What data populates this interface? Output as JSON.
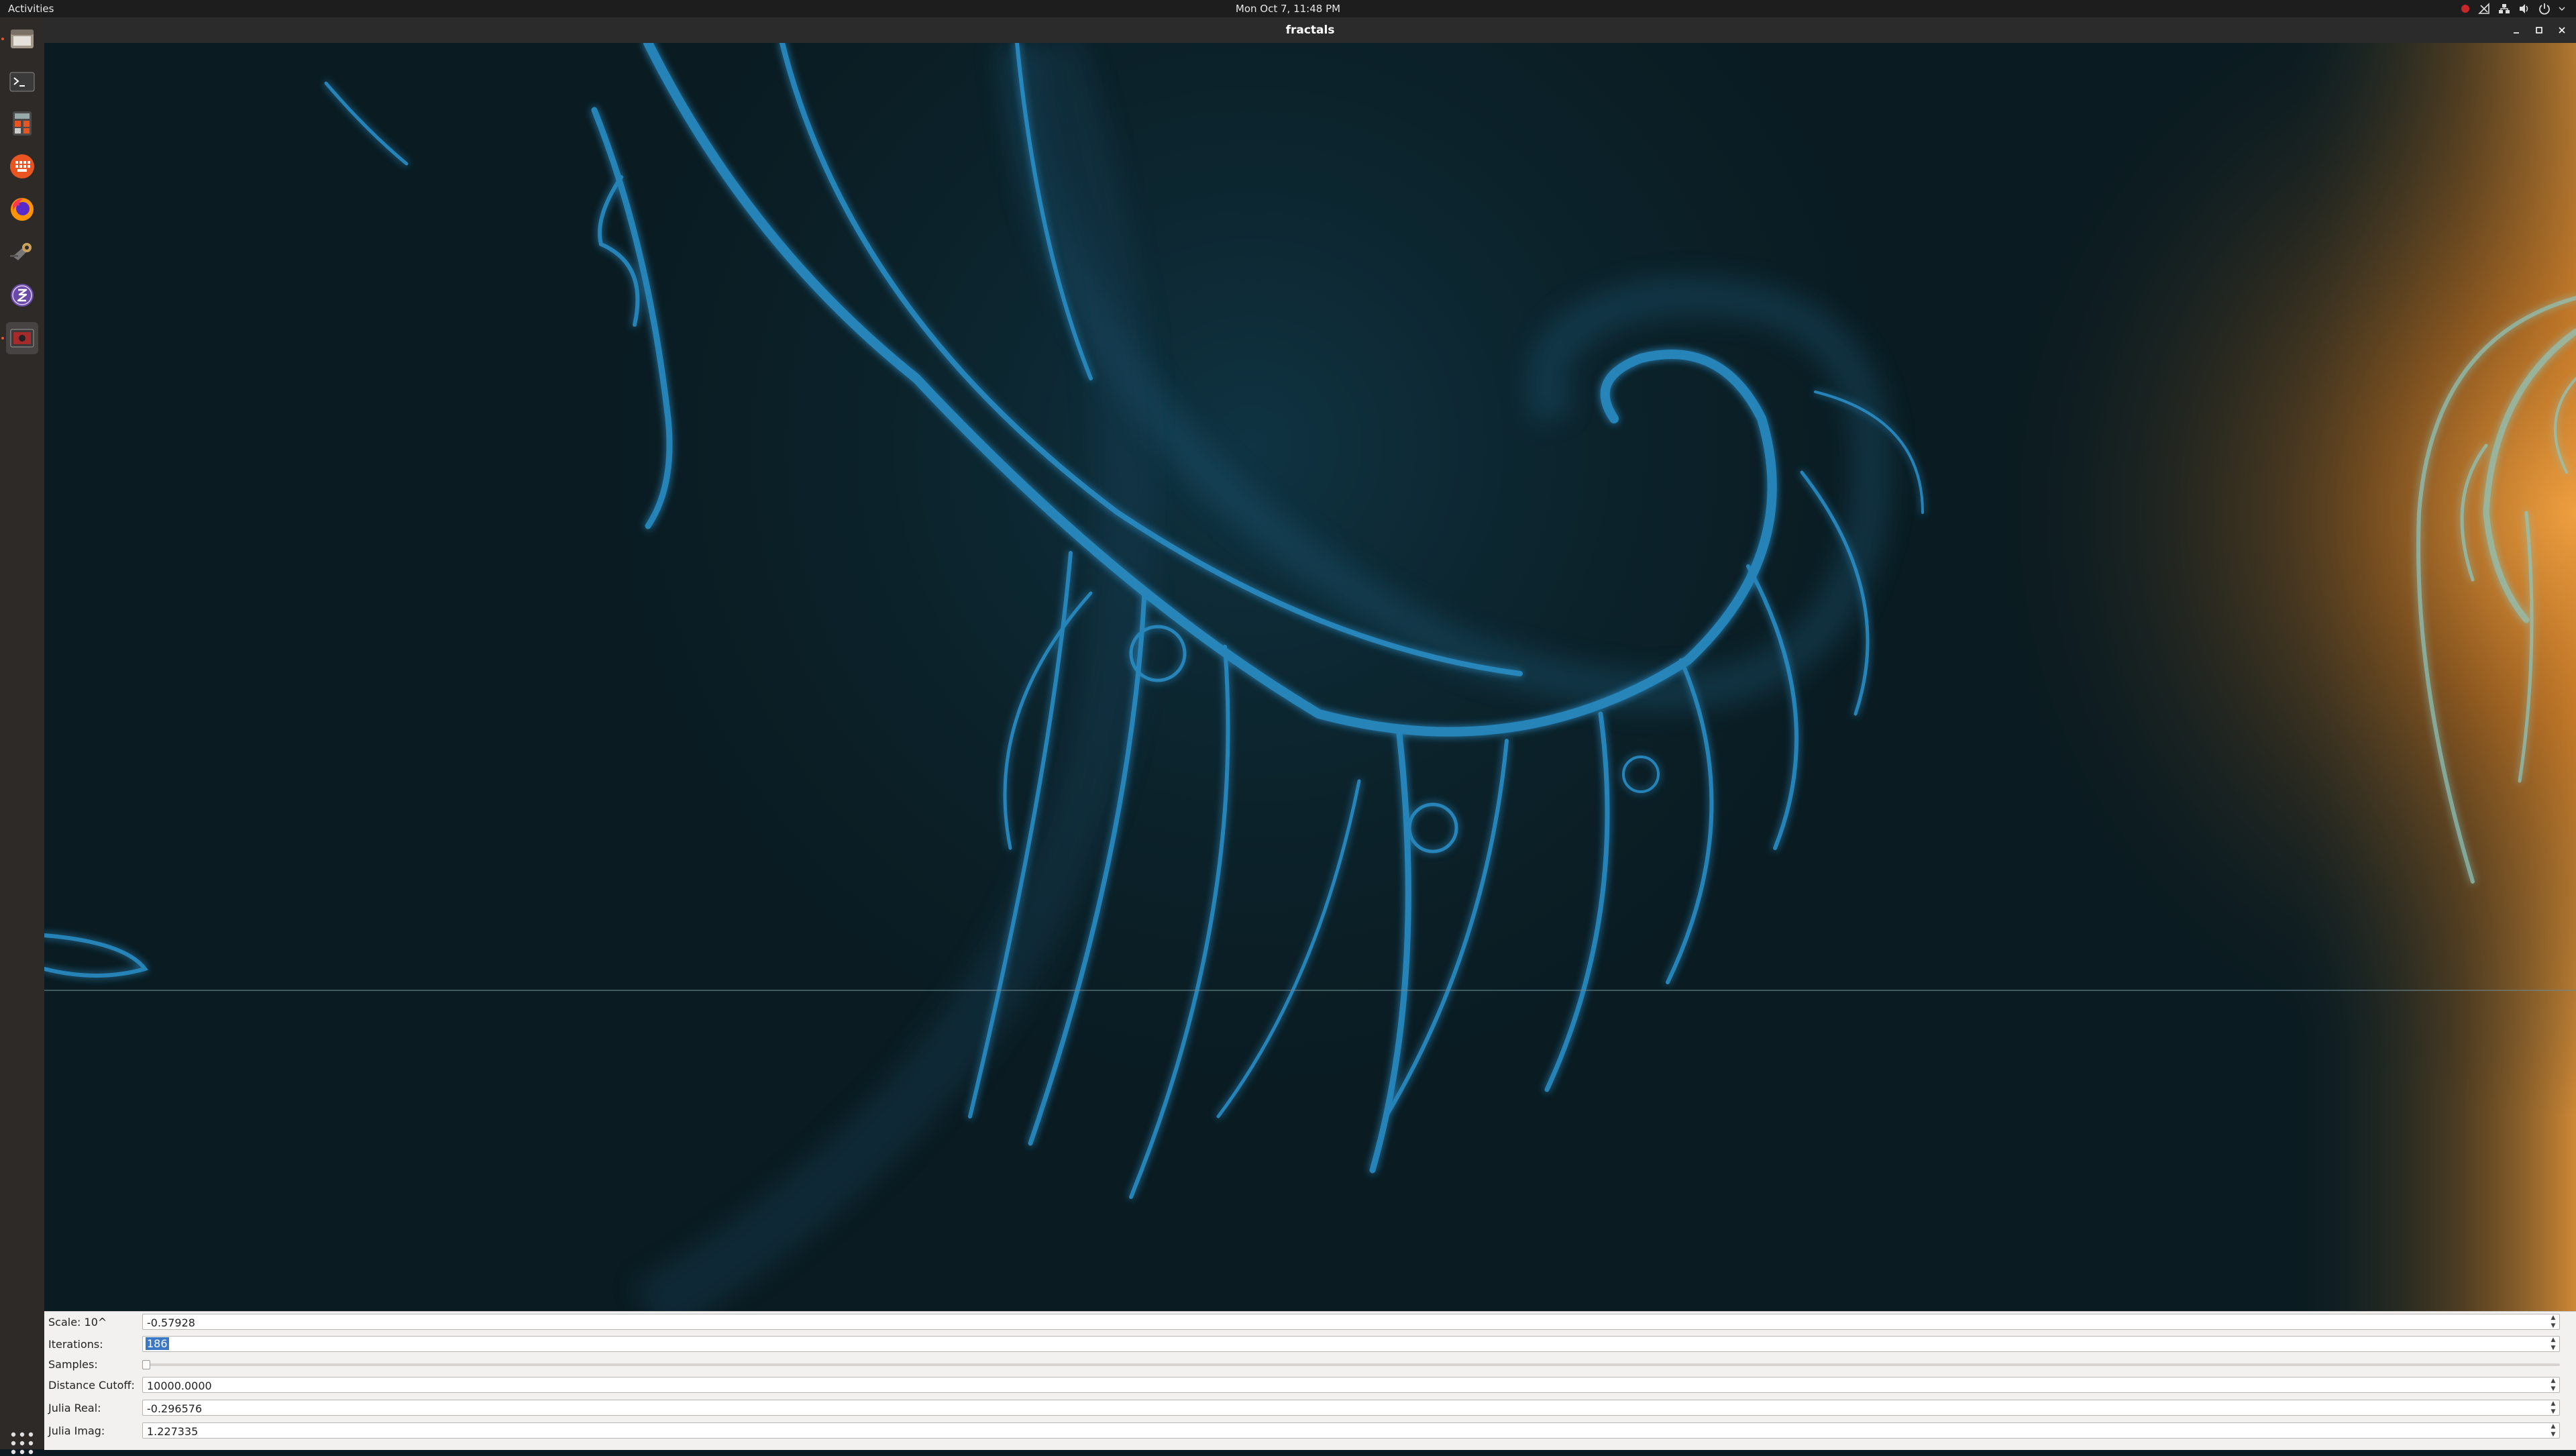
{
  "topbar": {
    "activities": "Activities",
    "clock": "Mon Oct  7, 11:48 PM",
    "tray_icons": [
      "record-indicator-icon",
      "network-icon",
      "volume-icon",
      "power-icon",
      "system-menu-chevron-icon"
    ]
  },
  "dock": {
    "items": [
      {
        "name": "files",
        "icon": "file-manager-icon"
      },
      {
        "name": "terminal",
        "icon": "terminal-icon"
      },
      {
        "name": "calculator",
        "icon": "calculator-icon"
      },
      {
        "name": "apps",
        "icon": "orange-grid-app-icon"
      },
      {
        "name": "firefox",
        "icon": "firefox-icon"
      },
      {
        "name": "tools",
        "icon": "wrench-tools-icon"
      },
      {
        "name": "emacs",
        "icon": "emacs-icon"
      },
      {
        "name": "fractals",
        "icon": "fractals-window-icon"
      }
    ],
    "show_apps_icon": "show-applications-grid-icon"
  },
  "window": {
    "title": "fractals",
    "controls": [
      "minimize-icon",
      "maximize-icon",
      "close-icon"
    ]
  },
  "controls": {
    "scale": {
      "label": "Scale: 10^",
      "value": "-0.57928"
    },
    "iterations": {
      "label": "Iterations:",
      "value": "186"
    },
    "samples": {
      "label": "Samples:",
      "level": 0.0
    },
    "distance_cutoff": {
      "label": "Distance Cutoff:",
      "value": "10000.0000"
    },
    "julia_real": {
      "label": "Julia Real:",
      "value": "-0.296576"
    },
    "julia_imag": {
      "label": "Julia Imag:",
      "value": "1.227335"
    }
  },
  "colors": {
    "fractal_blue": "#1f7fb8",
    "fractal_orange": "#e08a2a",
    "background": "#0a1b21",
    "selection": "#3a77c4",
    "ubuntu_orange": "#e95420"
  }
}
